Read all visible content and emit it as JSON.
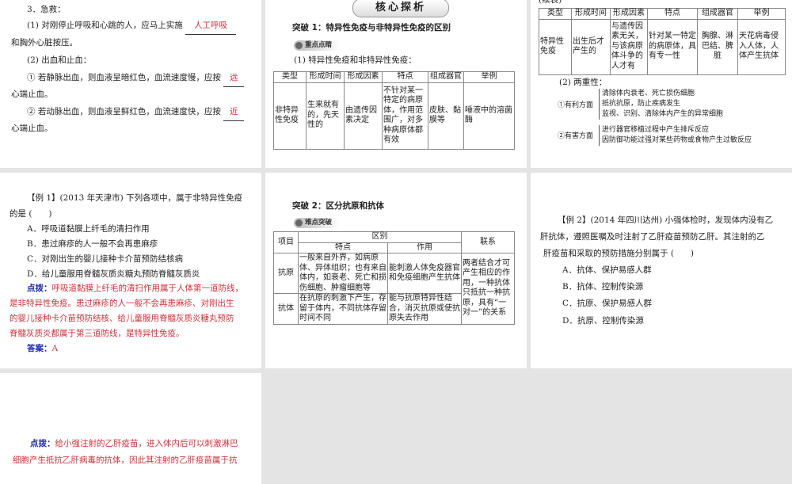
{
  "s1": {
    "title": "3．急救：",
    "l1a": "(1) 对刚停止呼吸和心跳的人，应马上实施",
    "a1": "人工呼吸",
    "l1b": "和胸外心脏按压。",
    "l2": "(2) 出血和止血：",
    "l3a": "① 若静脉出血，则血液呈暗红色，血流速度慢，应按",
    "a2": "远",
    "l3b": "心端止血。",
    "l4a": "② 若动脉出血，则血液呈鲜红色，血流速度快，应按",
    "a3": "近",
    "l4b": "心端止血。"
  },
  "s2": {
    "banner": "核心探析",
    "heading": "突破 1：特异性免疫与非特异性免疫的区别",
    "badge": "重点点睛",
    "intro": "(1) 特异性免疫和非特异性免疫：",
    "headers": [
      "类型",
      "形成时间",
      "形成因素",
      "特点",
      "组成器官",
      "举例"
    ],
    "row": [
      "非特异性免疫",
      "生来就有的，先天性的",
      "由遗传因素决定",
      "不针对某一特定的病原体，作用范围广，对多种病原体都有效",
      "皮肤、黏膜等",
      "唾液中的溶菌酶"
    ]
  },
  "s3": {
    "cont": "(续表)",
    "headers": [
      "类型",
      "形成时间",
      "形成因素",
      "特点",
      "组成器官",
      "举例"
    ],
    "row": [
      "特异性免疫",
      "出生后才产生的",
      "与遗传因素无关，与该病原体斗争的人才有",
      "针对某一特定的病原体，具有专一性",
      "胸腺、淋巴结、脾脏",
      "天花病毒侵入人体，人体产生抗体"
    ],
    "dual": "(2) 两重性：",
    "good_label": "①有利方面",
    "good": [
      "清除体内衰老、死亡损伤细胞",
      "抵抗抗原，防止疾病发生",
      "监视、识别、清除体内产生的异常细胞"
    ],
    "bad_label": "②有害方面",
    "bad": [
      "进行器官移植过程中产生排斥反应",
      "因防御功能过强对某些药物或食物产生过敏反应"
    ]
  },
  "s4": {
    "q1": "【例 1】(2013 年天津市) 下列各项中，属于非特异性免疫",
    "q2": "的是 (　　)",
    "opts": [
      "A．呼吸道黏膜上纤毛的清扫作用",
      "B．患过麻疹的人一般不会再患麻疹",
      "C．对刚出生的婴儿接种卡介苗预防结核病",
      "D．给儿童服用脊髓灰质炎糖丸预防脊髓灰质炎"
    ],
    "tip_label": "点拨：",
    "tip": [
      "呼吸道黏膜上纤毛的清扫作用属于人体第一道防线，",
      "是非特异性免疫。患过麻疹的人一般不会再患麻疹、对刚出生",
      "的婴儿接种卡介苗预防结核、给儿童服用脊髓灰质炎糖丸预防",
      "脊髓灰质炎都属于第三道防线，是特异性免疫。"
    ],
    "ans_label": "答案：",
    "ans": "A"
  },
  "s5": {
    "heading": "突破 2：区分抗原和抗体",
    "badge": "难点突破",
    "h_item": "项目",
    "h_diff": "区别",
    "h_feat": "特点",
    "h_func": "作用",
    "h_link": "联系",
    "r1": [
      "抗原",
      "一般来自外界，如病原体、异体组织；也有来自体内，如衰老、死亡和损伤细胞、肿瘤细胞等",
      "能刺激人体免疫器官和免疫细胞产生抗体"
    ],
    "r2": [
      "抗体",
      "在抗原的刺激下产生，存留于体内，不同抗体存留时间不同",
      "能与抗原特异性结合，消灭抗原或使抗原失去作用"
    ],
    "link": "两者结合才可产生相应的作用，一种抗体只抵抗一种抗原，具有“一对一”的关系"
  },
  "s6": {
    "q": [
      "【例 2】(2014 年四川达州) 小强体检时，发现体内没有乙",
      "肝抗体，遵照医嘱及时注射了乙肝疫苗预防乙肝。其注射的乙",
      "肝疫苗和采取的预防措施分别属于 (　　)"
    ],
    "opts": [
      "A．抗体、保护易感人群",
      "B．抗体、控制传染源",
      "C．抗原、保护易感人群",
      "D．抗原、控制传染源"
    ]
  },
  "s7": {
    "tip_label": "点拨：",
    "tip": [
      "给小强注射的乙肝疫苗，进入体内后可以刺激淋巴",
      "细胞产生抵抗乙肝病毒的抗体，因此其注射的乙肝疫苗属于抗"
    ]
  }
}
